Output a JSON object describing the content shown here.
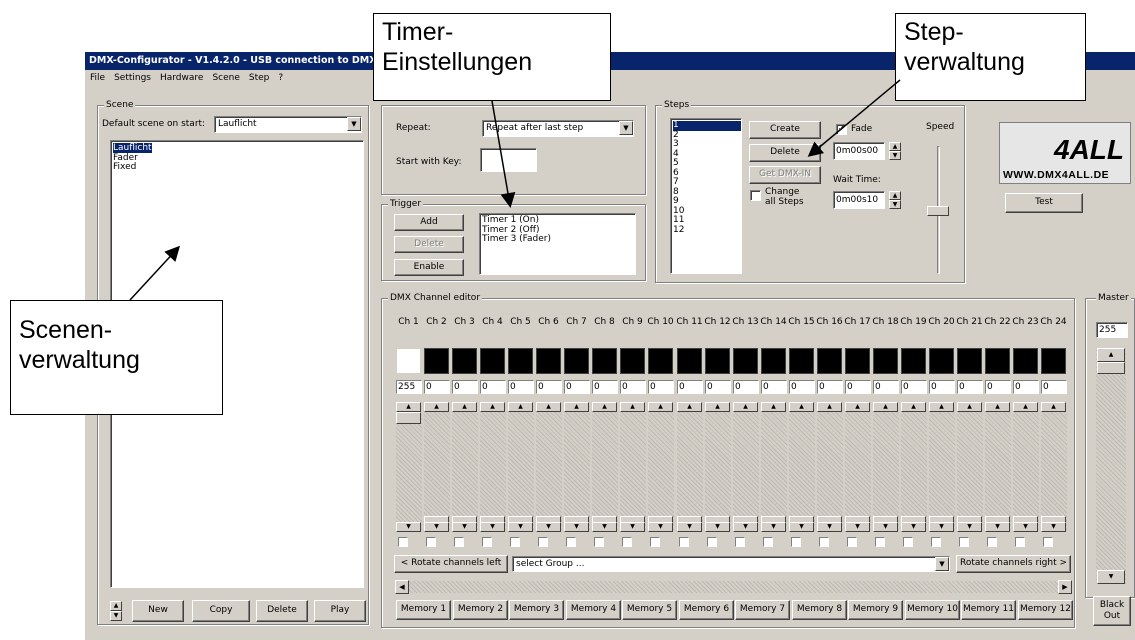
{
  "window": {
    "title": "DMX-Configurator - V1.4.2.0 - USB connection to DMX-"
  },
  "menu": [
    "File",
    "Settings",
    "Hardware",
    "Scene",
    "Step",
    "?"
  ],
  "scene": {
    "group_label": "Scene",
    "default_label": "Default scene on start:",
    "default_value": "Lauflicht",
    "items": [
      "Lauflicht",
      "Fader",
      "Fixed"
    ],
    "selected": "Lauflicht",
    "buttons": {
      "new": "New",
      "copy": "Copy",
      "delete": "Delete",
      "play": "Play"
    }
  },
  "timer": {
    "repeat_label": "Repeat:",
    "repeat_value": "Repeat after last step",
    "start_key_label": "Start with Key:",
    "start_key_value": ""
  },
  "trigger": {
    "group_label": "Trigger",
    "buttons": {
      "add": "Add",
      "delete": "Delete",
      "enable": "Enable"
    },
    "items": [
      "Timer 1 (On)",
      "Timer 2 (Off)",
      "Timer 3 (Fader)"
    ]
  },
  "steps": {
    "group_label": "Steps",
    "items": [
      "1",
      "2",
      "3",
      "4",
      "5",
      "6",
      "7",
      "8",
      "9",
      "10",
      "11",
      "12"
    ],
    "selected": "1",
    "buttons": {
      "create": "Create",
      "delete": "Delete",
      "get_dmx_in": "Get DMX-IN"
    },
    "change_all_label": "Change all Steps",
    "fade_label": "Fade",
    "fade_checked": true,
    "fade_time": "0m00s00",
    "wait_label": "Wait Time:",
    "wait_time": "0m00s10",
    "speed_label": "Speed"
  },
  "logo": {
    "url_text": "WWW.DMX4ALL.DE",
    "brand": "4ALL"
  },
  "test_button": "Test",
  "channel_editor": {
    "group_label": "DMX Channel editor",
    "channels": [
      {
        "label": "Ch 1",
        "value": "255"
      },
      {
        "label": "Ch 2",
        "value": "0"
      },
      {
        "label": "Ch 3",
        "value": "0"
      },
      {
        "label": "Ch 4",
        "value": "0"
      },
      {
        "label": "Ch 5",
        "value": "0"
      },
      {
        "label": "Ch 6",
        "value": "0"
      },
      {
        "label": "Ch 7",
        "value": "0"
      },
      {
        "label": "Ch 8",
        "value": "0"
      },
      {
        "label": "Ch 9",
        "value": "0"
      },
      {
        "label": "Ch 10",
        "value": "0"
      },
      {
        "label": "Ch 11",
        "value": "0"
      },
      {
        "label": "Ch 12",
        "value": "0"
      },
      {
        "label": "Ch 13",
        "value": "0"
      },
      {
        "label": "Ch 14",
        "value": "0"
      },
      {
        "label": "Ch 15",
        "value": "0"
      },
      {
        "label": "Ch 16",
        "value": "0"
      },
      {
        "label": "Ch 17",
        "value": "0"
      },
      {
        "label": "Ch 18",
        "value": "0"
      },
      {
        "label": "Ch 19",
        "value": "0"
      },
      {
        "label": "Ch 20",
        "value": "0"
      },
      {
        "label": "Ch 21",
        "value": "0"
      },
      {
        "label": "Ch 22",
        "value": "0"
      },
      {
        "label": "Ch 23",
        "value": "0"
      },
      {
        "label": "Ch 24",
        "value": "0"
      }
    ],
    "rotate_left": "< Rotate channels left",
    "rotate_right": "Rotate channels right >",
    "group_select": "select Group ...",
    "memories": [
      "Memory 1",
      "Memory 2",
      "Memory 3",
      "Memory 4",
      "Memory 5",
      "Memory 6",
      "Memory 7",
      "Memory 8",
      "Memory 9",
      "Memory 10",
      "Memory 11",
      "Memory 12"
    ]
  },
  "master": {
    "label": "Master",
    "value": "255",
    "blackout": "Black Out"
  },
  "callouts": {
    "timer": "Timer-\nEinstellungen",
    "step": "Step-\nverwaltung",
    "scene": "Scenen-\nverwaltung"
  }
}
